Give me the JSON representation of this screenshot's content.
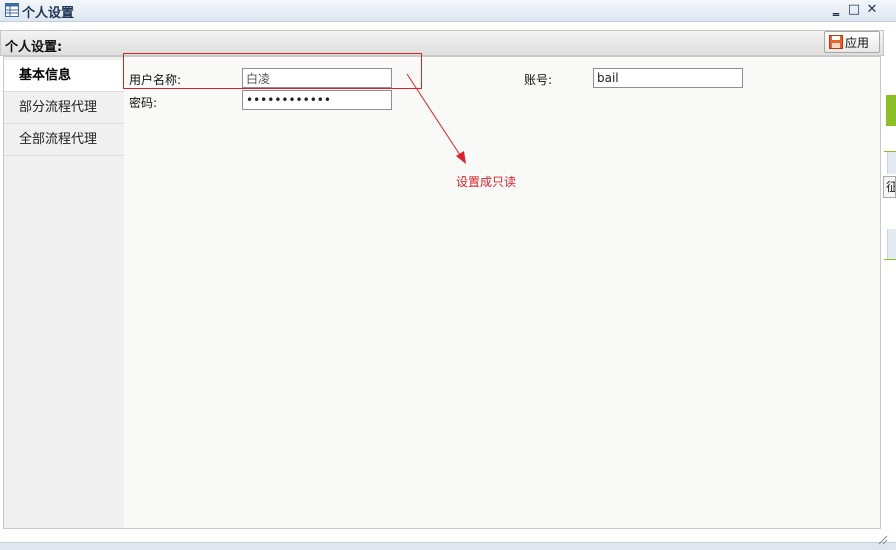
{
  "window": {
    "title": "个人设置",
    "minimize": "‗",
    "maximize": "□",
    "close": "✕"
  },
  "panel": {
    "title": "个人设置:",
    "apply_label": "应用"
  },
  "sidebar": {
    "items": [
      {
        "label": "基本信息"
      },
      {
        "label": "部分流程代理"
      },
      {
        "label": "全部流程代理"
      }
    ]
  },
  "form": {
    "username_label": "用户名称:",
    "username_value": "白凌",
    "password_label": "密码:",
    "password_value": "••••••••••••",
    "account_label": "账号:",
    "account_value": "bail"
  },
  "annotation": {
    "text": "设置成只读",
    "color": "#d9232a"
  },
  "edge": {
    "button_text": "征"
  },
  "colors": {
    "accent_green": "#8cbf26",
    "title_text": "#1f3553"
  }
}
